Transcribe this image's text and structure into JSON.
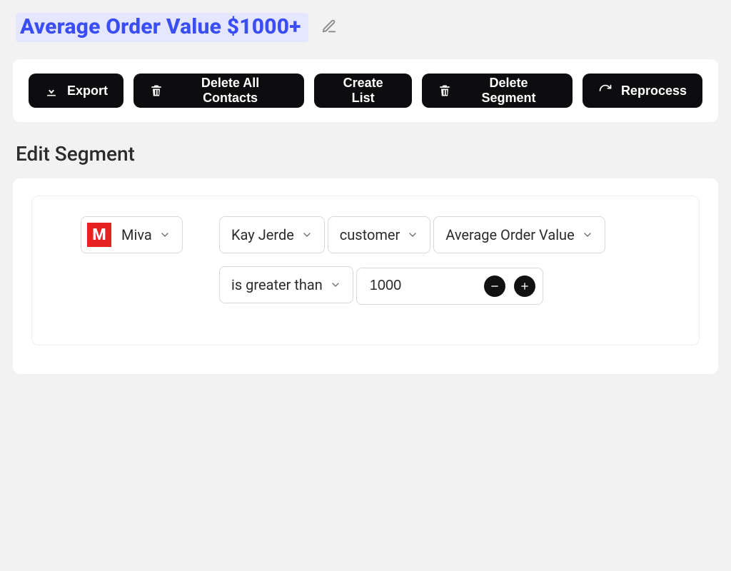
{
  "header": {
    "segment_title": "Average Order Value $1000+"
  },
  "toolbar": {
    "export_label": "Export",
    "delete_contacts_label": "Delete All Contacts",
    "create_list_label": "Create List",
    "delete_segment_label": "Delete Segment",
    "reprocess_label": "Reprocess"
  },
  "section": {
    "edit_segment_heading": "Edit Segment"
  },
  "rule": {
    "source": {
      "provider_label": "Miva",
      "logo_letter": "M"
    },
    "account_label": "Kay Jerde",
    "entity_label": "customer",
    "metric_label": "Average Order Value",
    "comparator_label": "is greater than",
    "value": "1000"
  }
}
